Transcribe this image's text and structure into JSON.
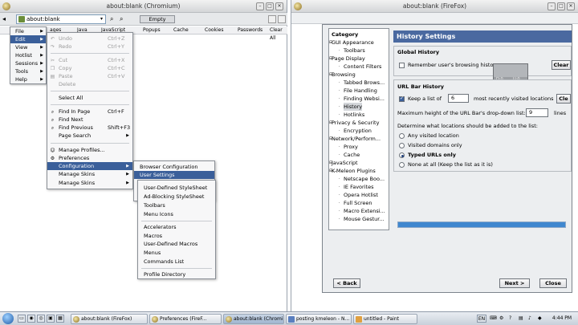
{
  "left_window": {
    "title": "about:blank (Chromium)",
    "url": "about:blank",
    "empty_label": "Empty",
    "bookmarks": [
      "ages",
      "Java",
      "JavaScript",
      "Popups",
      "Cache",
      "Cookies",
      "Passwords",
      "Clear All"
    ]
  },
  "main_menu": {
    "items": [
      {
        "label": "File",
        "has_sub": true
      },
      {
        "label": "Edit",
        "has_sub": true
      },
      {
        "label": "View",
        "has_sub": true
      },
      {
        "label": "Hotlist",
        "has_sub": true
      },
      {
        "label": "Sessions",
        "has_sub": true
      },
      {
        "label": "Tools",
        "has_sub": true
      },
      {
        "label": "Help",
        "has_sub": true
      }
    ]
  },
  "edit_menu": {
    "items": [
      {
        "label": "Undo",
        "shortcut": "Ctrl+Z",
        "enabled": false
      },
      {
        "label": "Redo",
        "shortcut": "Ctrl+Y",
        "enabled": false
      },
      {
        "label": "Cut",
        "shortcut": "Ctrl+X",
        "enabled": false
      },
      {
        "label": "Copy",
        "shortcut": "Ctrl+C",
        "enabled": false
      },
      {
        "label": "Paste",
        "shortcut": "Ctrl+V",
        "enabled": false
      },
      {
        "label": "Delete",
        "shortcut": "",
        "enabled": false
      },
      {
        "label": "Select All",
        "shortcut": "",
        "enabled": true
      },
      {
        "label": "Find In Page",
        "shortcut": "Ctrl+F",
        "enabled": true
      },
      {
        "label": "Find Next",
        "shortcut": "",
        "enabled": true
      },
      {
        "label": "Find Previous",
        "shortcut": "Shift+F3",
        "enabled": true
      },
      {
        "label": "Page Search",
        "shortcut": "",
        "enabled": true
      },
      {
        "label": "Manage Profiles...",
        "shortcut": "",
        "enabled": true
      },
      {
        "label": "Preferences",
        "shortcut": "",
        "enabled": true
      },
      {
        "label": "Configuration",
        "shortcut": "",
        "enabled": true
      },
      {
        "label": "Manage Skins",
        "shortcut": "",
        "enabled": true
      },
      {
        "label": "Manage Skins",
        "shortcut": "",
        "enabled": true
      }
    ]
  },
  "config_menu": {
    "items": [
      "Browser Configuration",
      "User Settings"
    ]
  },
  "user_settings_menu": {
    "items": [
      "User-Defined StyleSheet",
      "Ad-Blocking StyleSheet",
      "Toolbars",
      "Menu Icons",
      "Accelerators",
      "Macros",
      "User-Defined Macros",
      "Menus",
      "Commands List",
      "Profile Directory"
    ]
  },
  "right_window": {
    "title": "about:blank (FireFox)"
  },
  "prefs": {
    "category_header": "Category",
    "categories": [
      {
        "label": "GUI Appearance",
        "level": 0
      },
      {
        "label": "Toolbars",
        "level": 1
      },
      {
        "label": "Page Display",
        "level": 0
      },
      {
        "label": "Content Filters",
        "level": 1
      },
      {
        "label": "Browsing",
        "level": 0
      },
      {
        "label": "Tabbed Brows...",
        "level": 1
      },
      {
        "label": "File Handling",
        "level": 1
      },
      {
        "label": "Finding Websi...",
        "level": 1
      },
      {
        "label": "History",
        "level": 1
      },
      {
        "label": "Hotlinks",
        "level": 1
      },
      {
        "label": "Privacy & Security",
        "level": 0
      },
      {
        "label": "Encryption",
        "level": 1
      },
      {
        "label": "Network/Perform...",
        "level": 0
      },
      {
        "label": "Proxy",
        "level": 1
      },
      {
        "label": "Cache",
        "level": 1
      },
      {
        "label": "JavaScript",
        "level": 0
      },
      {
        "label": "K-Meleon Plugins",
        "level": 0
      },
      {
        "label": "Netscape Boo...",
        "level": 1
      },
      {
        "label": "IE Favorites",
        "level": 1
      },
      {
        "label": "Opera Hotlist",
        "level": 1
      },
      {
        "label": "Full Screen",
        "level": 1
      },
      {
        "label": "Macro Extensi...",
        "level": 1
      },
      {
        "label": "Mouse Gestur...",
        "level": 1
      }
    ],
    "header": "History Settings",
    "global_history": {
      "title": "Global History",
      "remember_label": "Remember user's browsing histor",
      "remember_checked": false,
      "clear_button": "Clear",
      "tooltip_left": "D:0",
      "tooltip_right": "U:0"
    },
    "url_bar_history": {
      "title": "URL Bar History",
      "keep_checked": true,
      "keep_prefix": "Keep a list of",
      "keep_count": "6",
      "keep_suffix": "most recently visited locations",
      "clear_button": "Cle",
      "max_height_label": "Maximum height of the URL Bar's drop-down list:",
      "max_height_value": "9",
      "lines_label": "lines",
      "determine_label": "Determine what locations should be added to the list:",
      "options": [
        {
          "label": "Any visited location",
          "selected": false
        },
        {
          "label": "Visited domains only",
          "selected": false
        },
        {
          "label": "Typed URLs only",
          "selected": true
        },
        {
          "label": "None at all (Keep the list as it is)",
          "selected": false
        }
      ]
    },
    "progress_fraction": 1.0,
    "back_button": "< Back",
    "next_button": "Next >",
    "close_button": "Close"
  },
  "taskbar": {
    "items": [
      {
        "label": "about:blank (FireFox)",
        "active": false
      },
      {
        "label": "Preferences (FireF...",
        "active": false
      },
      {
        "label": "about:blank (Chromi",
        "active": true
      },
      {
        "label": "posting kmeleon - N...",
        "active": false
      },
      {
        "label": "untitled - Paint",
        "active": false
      }
    ],
    "lang": "EN",
    "clock": "4:44 PM"
  },
  "colors": {
    "highlight": "#3a5f9a",
    "header_blue": "#4a69a0",
    "progress": "#3f87cf"
  }
}
